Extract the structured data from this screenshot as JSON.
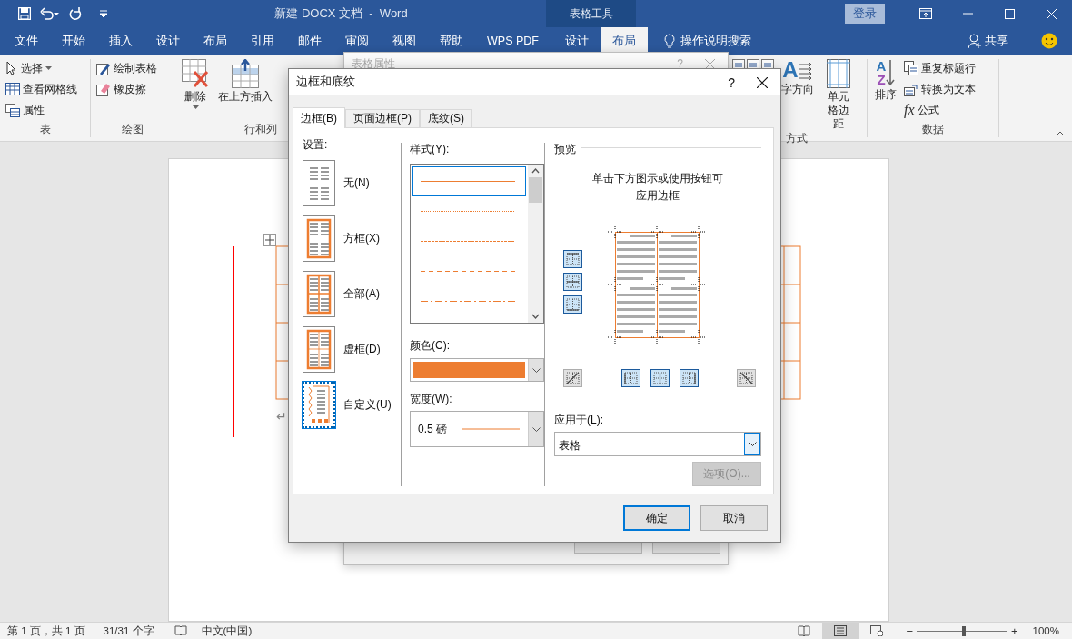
{
  "title_bar": {
    "title": "新建 DOCX 文档  -  Word",
    "context_label": "表格工具",
    "sign_in": "登录"
  },
  "menu_tabs": [
    {
      "label": "文件",
      "selected": false
    },
    {
      "label": "开始",
      "selected": false
    },
    {
      "label": "插入",
      "selected": false
    },
    {
      "label": "设计",
      "selected": false
    },
    {
      "label": "布局",
      "selected": false
    },
    {
      "label": "引用",
      "selected": false
    },
    {
      "label": "邮件",
      "selected": false
    },
    {
      "label": "审阅",
      "selected": false
    },
    {
      "label": "视图",
      "selected": false
    },
    {
      "label": "帮助",
      "selected": false
    },
    {
      "label": "WPS PDF",
      "selected": false
    }
  ],
  "context_tabs": [
    {
      "label": "设计",
      "selected": false
    },
    {
      "label": "布局",
      "selected": true
    }
  ],
  "tell_me": "操作说明搜索",
  "share": "共享",
  "ribbon_left": [
    {
      "label": "表",
      "items": [
        {
          "kind": "small",
          "label": "选择",
          "menu": true
        },
        {
          "kind": "small",
          "label": "查看网格线"
        },
        {
          "kind": "small",
          "label": "属性"
        }
      ]
    },
    {
      "label": "绘图",
      "items": [
        {
          "kind": "small",
          "label": "绘制表格"
        },
        {
          "kind": "small",
          "label": "橡皮擦"
        }
      ]
    },
    {
      "label": "行和列",
      "items": [
        {
          "kind": "large",
          "label": "删除",
          "menu": true
        },
        {
          "kind": "large",
          "label": "在上方插入"
        }
      ]
    }
  ],
  "ribbon_right": [
    {
      "label": "方式",
      "items": [
        {
          "kind": "align"
        },
        {
          "kind": "large",
          "label": "字方向",
          "glyphs": [
            "A"
          ]
        },
        {
          "kind": "large",
          "label": "单元格边距"
        }
      ]
    },
    {
      "label": "数据",
      "items": [
        {
          "kind": "large",
          "label": "排序",
          "glyphs": [
            "A",
            "Z"
          ]
        },
        {
          "kind": "small",
          "label": "重复标题行"
        },
        {
          "kind": "small",
          "label": "转换为文本"
        },
        {
          "kind": "small",
          "label": "公式",
          "glyphs": [
            "fx"
          ]
        }
      ]
    }
  ],
  "document": {
    "paragraph_mark": "↵"
  },
  "back_dialog": {
    "title": "表格属性",
    "help": "?"
  },
  "dialog": {
    "title": "边框和底纹",
    "help": "?",
    "tabs": [
      {
        "label": "边框(B)",
        "selected": true
      },
      {
        "label": "页面边框(P)",
        "selected": false
      },
      {
        "label": "底纹(S)",
        "selected": false
      }
    ],
    "settings_label": "设置:",
    "settings": [
      {
        "kind": "none",
        "label": "无(N)",
        "selected": false
      },
      {
        "kind": "box",
        "label": "方框(X)",
        "selected": false
      },
      {
        "kind": "all",
        "label": "全部(A)",
        "selected": false
      },
      {
        "kind": "grid",
        "label": "虚框(D)",
        "selected": false
      },
      {
        "kind": "custom",
        "label": "自定义(U)",
        "selected": true
      }
    ],
    "style_label": "样式(Y):",
    "styles": [
      {
        "kind": "solid",
        "selected": true
      },
      {
        "kind": "dotted",
        "selected": false
      },
      {
        "kind": "fine-dash",
        "selected": false
      },
      {
        "kind": "dashed",
        "selected": false
      },
      {
        "kind": "dash-dot",
        "selected": false
      }
    ],
    "color_label": "颜色(C):",
    "color": "#ed7d31",
    "width_label": "宽度(W):",
    "width_value": "0.5 磅",
    "preview_label": "预览",
    "preview_hint": "单击下方图示或使用按钮可应用边框",
    "border_buttons_side": [
      {
        "kind": "top",
        "pressed": true
      },
      {
        "kind": "inside-h",
        "pressed": true
      },
      {
        "kind": "bottom",
        "pressed": true
      }
    ],
    "border_buttons_bottom": [
      {
        "kind": "diag-up",
        "pressed": false
      },
      {
        "kind": "left",
        "pressed": true
      },
      {
        "kind": "inside-v",
        "pressed": true
      },
      {
        "kind": "right",
        "pressed": true
      },
      {
        "kind": "diag-down",
        "pressed": false
      }
    ],
    "apply_label": "应用于(L):",
    "apply_value": "表格",
    "options_button": {
      "label": "选项(O)...",
      "disabled": true
    },
    "ok": "确定",
    "cancel": "取消"
  },
  "status_bar": {
    "page": "第 1 页，共 1 页",
    "words": "31/31 个字",
    "language": "中文(中国)",
    "views": [
      {
        "kind": "read",
        "selected": false
      },
      {
        "kind": "print",
        "selected": true
      },
      {
        "kind": "web",
        "selected": false
      }
    ],
    "zoom_out": "−",
    "zoom_in": "+",
    "zoom": {
      "level": 0.52
    },
    "zoom_text": "100%"
  }
}
